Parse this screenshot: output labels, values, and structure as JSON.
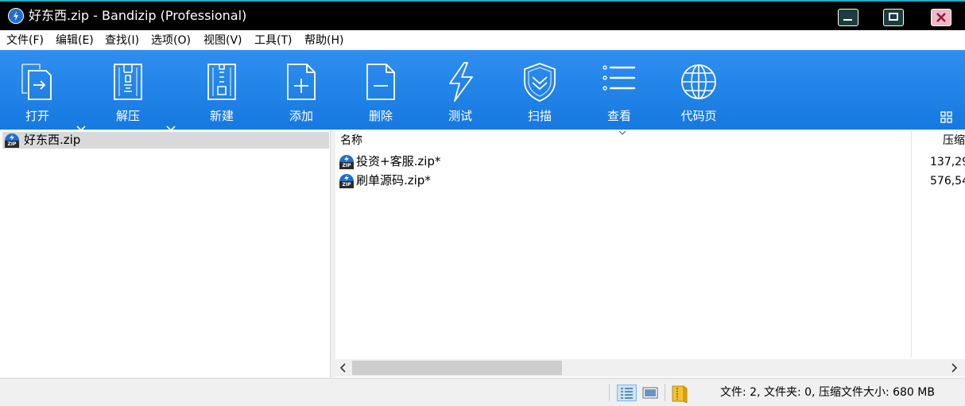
{
  "window": {
    "title": "好东西.zip - Bandizip (Professional)"
  },
  "menu": [
    "文件(F)",
    "编辑(E)",
    "查找(I)",
    "选项(O)",
    "视图(V)",
    "工具(T)",
    "帮助(H)"
  ],
  "toolbar": {
    "open": "打开",
    "extract": "解压",
    "new": "新建",
    "add": "添加",
    "delete": "删除",
    "test": "测试",
    "scan": "扫描",
    "view": "查看",
    "codepage": "代码页"
  },
  "tree": {
    "root": "好东西.zip"
  },
  "list": {
    "columns": {
      "name": "名称",
      "size": "压缩"
    },
    "rows": [
      {
        "name": "投资+客服.zip*",
        "size": "137,29"
      },
      {
        "name": "刷单源码.zip*",
        "size": "576,54"
      }
    ]
  },
  "status": {
    "text": "文件: 2, 文件夹: 0, 压缩文件大小: 680 MB"
  },
  "colors": {
    "titlebar": "#000000",
    "toolbar": "#1f83ea",
    "accent": "#1fb0c4",
    "selection": "#d9d9d9"
  },
  "icons": [
    "app-logo-icon",
    "minimize-icon",
    "maximize-icon",
    "close-icon",
    "open-icon",
    "extract-icon",
    "new-archive-icon",
    "add-icon",
    "delete-icon",
    "test-icon",
    "scan-shield-icon",
    "view-list-icon",
    "codepage-globe-icon",
    "layout-icon",
    "zip-file-icon",
    "details-view-icon",
    "thumbnail-view-icon",
    "archive-folder-icon"
  ]
}
